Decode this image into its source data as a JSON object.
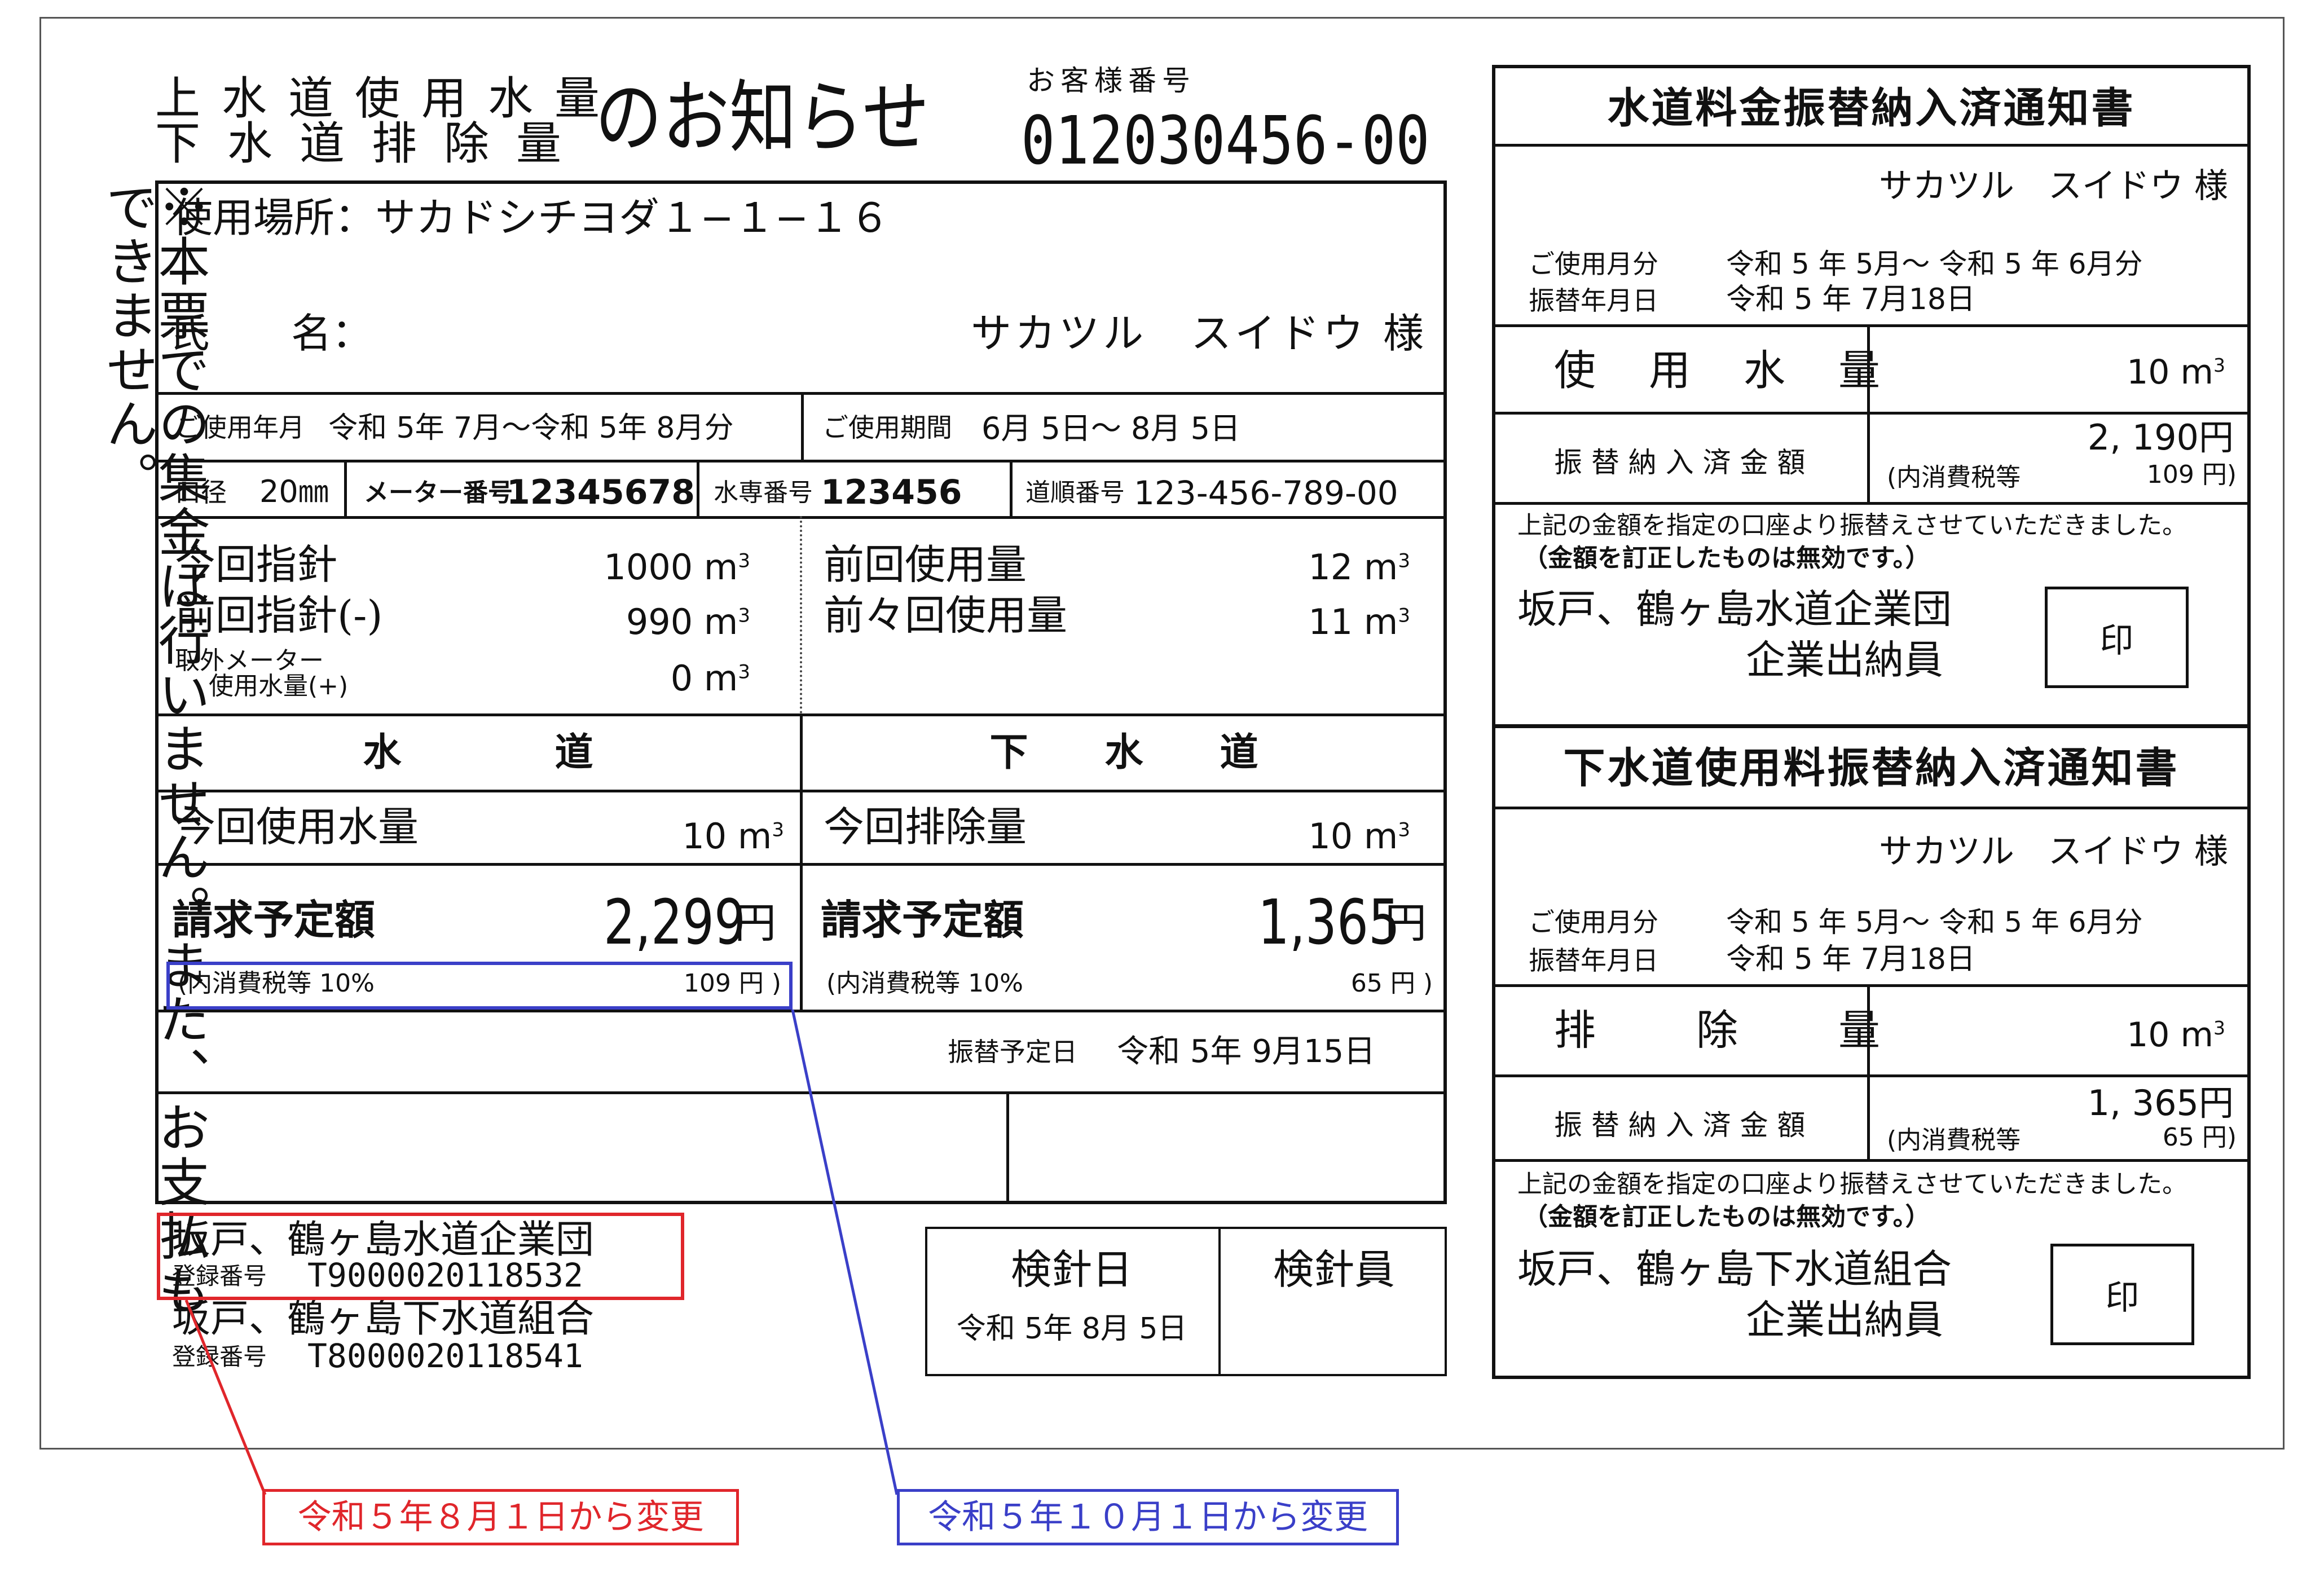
{
  "title": {
    "line1": "上水道使用水量",
    "line2": "下水道排除量",
    "suffix": "のお知らせ"
  },
  "customer": {
    "label": "お客様番号",
    "number": "012030456-00"
  },
  "notice_vertical": "※本票での集金は行いません。また、お支払もできません。",
  "usage_place": "使用場所：サカドシチヨダ１−１−１６",
  "name": {
    "label": "氏　　名：",
    "value": "サカツル　スイドウ 様"
  },
  "period": {
    "usage_month_label": "ご使用年月",
    "usage_month_value": "令和 5年  7月〜令和 5年  8月分",
    "usage_period_label": "ご使用期間",
    "usage_period_value": "6月  5日〜  8月  5日"
  },
  "meter_info": {
    "caliber_label": "口径",
    "caliber_value": "20㎜",
    "meter_no_label": "メーター番号",
    "meter_no_value": "12345678",
    "water_no_label": "水専番号",
    "water_no_value": "123456",
    "route_label": "道順番号",
    "route_value": "123-456-789-00"
  },
  "readings": {
    "current_label": "今回指針",
    "current_value": "1000 m",
    "previous_label": "前回指針(-)",
    "previous_value": "990 m",
    "removed_label_1": "取外メーター",
    "removed_label_2": "使用水量(+)",
    "removed_value": "0 m",
    "prev_usage_label": "前回使用量",
    "prev_usage_value": "12 m",
    "prev2_usage_label": "前々回使用量",
    "prev2_usage_value": "11 m",
    "unit_sup": "3"
  },
  "water": {
    "header": "水　　　　道",
    "usage_label": "今回使用水量",
    "usage_value": "10 m",
    "billing_label": "請求予定額",
    "billing_amount": "2,299",
    "yen": "円",
    "tax_label": "(内消費税等 10%",
    "tax_value": "109 円 )"
  },
  "sewer": {
    "header": "下　　水　　道",
    "usage_label": "今回排除量",
    "usage_value": "10 m",
    "billing_label": "請求予定額",
    "billing_amount": "1,365",
    "yen": "円",
    "tax_label": "(内消費税等 10%",
    "tax_value": "65 円 )"
  },
  "transfer": {
    "label": "振替予定日",
    "value": "令和 5年  9月15日"
  },
  "registrations": {
    "org1": "坂戸、鶴ヶ島水道企業団",
    "reg_label": "登録番号",
    "reg1": "T9000020118532",
    "org2": "坂戸、鶴ヶ島下水道組合",
    "reg2": "T8000020118541"
  },
  "inspection": {
    "date_label": "検針日",
    "date_value": "令和 5年  8月  5日",
    "inspector_label": "検針員"
  },
  "water_notice": {
    "title": "水道料金振替納入済通知書",
    "name": "サカツル　スイドウ 様",
    "usage_month_label": "ご使用月分",
    "usage_month_value": "令和 5 年   5月〜 令和 5 年   6月分",
    "transfer_date_label": "振替年月日",
    "transfer_date_value": "令和 5 年   7月18日",
    "amount_row_label": "使　用　水　量",
    "amount_row_value": "10 m",
    "paid_label": "振 替 納 入 済 金 額",
    "paid_amount": "2, 190円",
    "paid_tax_label": "(内消費税等",
    "paid_tax_value": "109 円)",
    "note1": "上記の金額を指定の口座より振替えさせていただきました。",
    "note2": "（金額を訂正したものは無効です。）",
    "org": "坂戸、鶴ヶ島水道企業団",
    "officer": "企業出納員",
    "stamp": "印"
  },
  "sewer_notice": {
    "title": "下水道使用料振替納入済通知書",
    "name": "サカツル　スイドウ 様",
    "usage_month_label": "ご使用月分",
    "usage_month_value": "令和 5 年   5月〜 令和 5 年   6月分",
    "transfer_date_label": "振替年月日",
    "transfer_date_value": "令和 5 年   7月18日",
    "amount_row_label": "排　　除　　量",
    "amount_row_value": "10 m",
    "paid_label": "振 替 納 入 済 金 額",
    "paid_amount": "1, 365円",
    "paid_tax_label": "(内消費税等",
    "paid_tax_value": "65 円)",
    "note1": "上記の金額を指定の口座より振替えさせていただきました。",
    "note2": "（金額を訂正したものは無効です。）",
    "org": "坂戸、鶴ヶ島下水道組合",
    "officer": "企業出納員",
    "stamp": "印"
  },
  "annotations": {
    "red_label": "令和５年８月１日から変更",
    "red_color": "#e0262b",
    "blue_label": "令和５年１０月１日から変更",
    "blue_color": "#3a3fc8"
  }
}
